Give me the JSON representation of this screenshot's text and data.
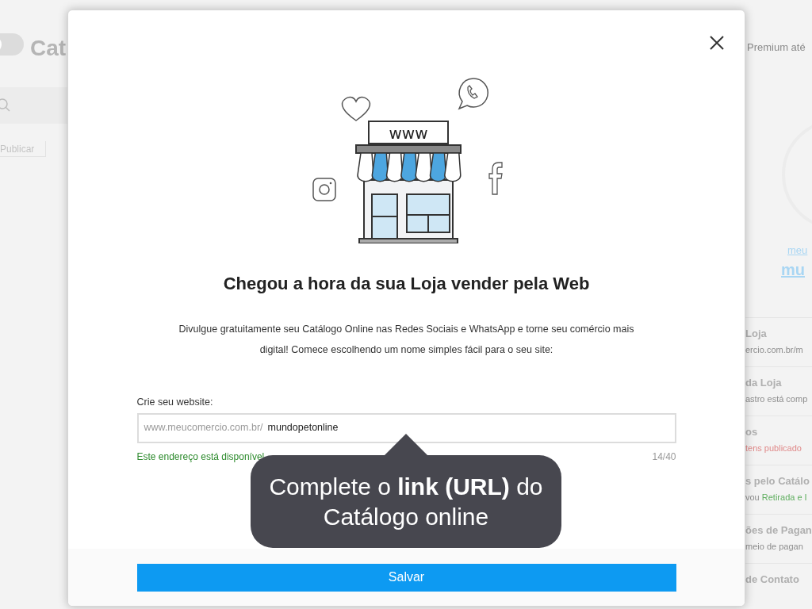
{
  "background": {
    "header_title": "Cat",
    "toggle": {
      "on": false
    },
    "tab": "Publicar",
    "plan": "Premium até",
    "store_link_small": "meu",
    "store_link_large": "mu",
    "menu": [
      {
        "title": "Loja",
        "subtitle": "ercio.com.br/m",
        "kind": "plain"
      },
      {
        "title": "da Loja",
        "subtitle": "astro está comp",
        "kind": "plain"
      },
      {
        "title": "os",
        "subtitle": "tens publicado",
        "kind": "alert"
      },
      {
        "title": "s pelo Catálo",
        "subtitle": "vou **Retirada e I**",
        "kind": "highlight"
      },
      {
        "title": "ões de Pagan",
        "subtitle": "meio de pagan",
        "kind": "plain"
      },
      {
        "title": "de Contato"
      }
    ]
  },
  "modal": {
    "illustration_sign": "www",
    "title": "Chegou a hora da sua Loja vender pela Web",
    "description": "Divulgue gratuitamente seu Catálogo Online nas Redes Sociais e WhatsApp e torne seu comércio mais digital! Comece escolhendo um nome simples fácil para o seu site:",
    "field_label": "Crie seu website:",
    "prefix": "www.meucomercio.com.br/",
    "value": "mundopetonline",
    "status": "Este endereço está disponível",
    "available": true,
    "counter": "14/40",
    "save_button": "Salvar"
  },
  "tooltip": {
    "text": "Complete o **link (URL)** do Catálogo online"
  }
}
